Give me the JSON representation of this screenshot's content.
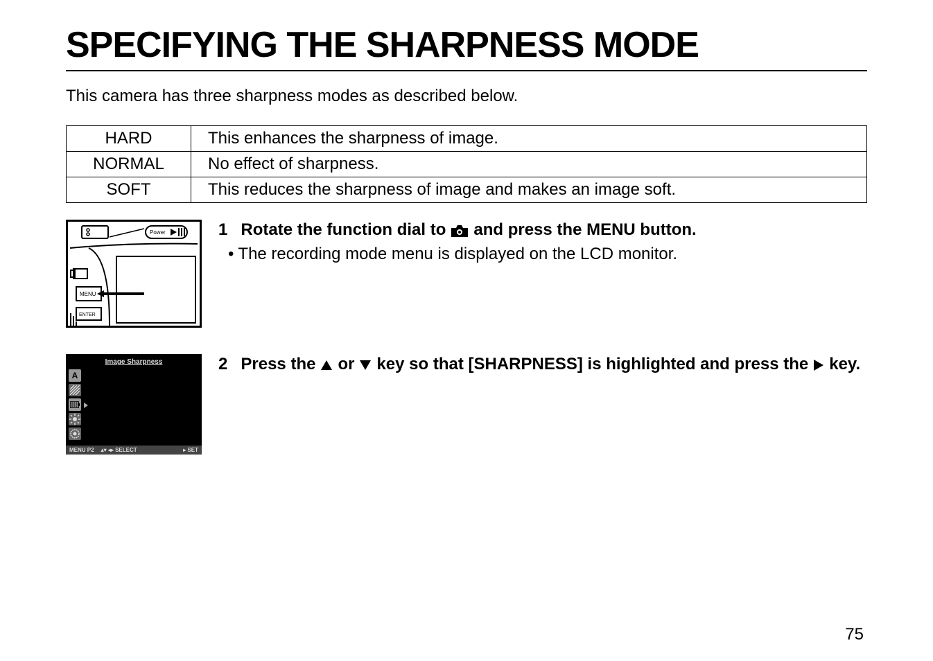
{
  "page_title": "SPECIFYING THE SHARPNESS MODE",
  "intro": "This camera has three sharpness modes as described below.",
  "table": {
    "rows": [
      {
        "label": "HARD",
        "desc": "This enhances the sharpness of image."
      },
      {
        "label": "NORMAL",
        "desc": "No effect of sharpness."
      },
      {
        "label": "SOFT",
        "desc": "This reduces the sharpness of image and makes an image soft."
      }
    ]
  },
  "steps": [
    {
      "num": "1",
      "heading": {
        "before": "Rotate the function dial to",
        "icon": "camera-icon",
        "after": "and press the MENU button."
      },
      "bullet": "The recording mode menu is displayed on the LCD monitor.",
      "figure": "camera-diagram",
      "camera_labels": {
        "power": "Power",
        "menu": "MENU",
        "enter": "ENTER",
        "disp": ""
      }
    },
    {
      "num": "2",
      "heading": {
        "before": "Press the",
        "icon1": "up-arrow-icon",
        "mid1": "or",
        "icon2": "down-arrow-icon",
        "mid2": "key so that [SHARPNESS] is highlighted and press the",
        "icon3": "right-arrow-icon",
        "after": "key."
      },
      "figure": "lcd-sharpness",
      "lcd": {
        "title": "Image Sharpness",
        "icons": [
          "A",
          "hatch",
          "battery",
          "brightness",
          "self-timer"
        ],
        "footer": {
          "left1": "MENU P2",
          "left2": "▴▾ ◂▸ SELECT",
          "right": "▸ SET"
        }
      }
    }
  ],
  "page_number": "75"
}
